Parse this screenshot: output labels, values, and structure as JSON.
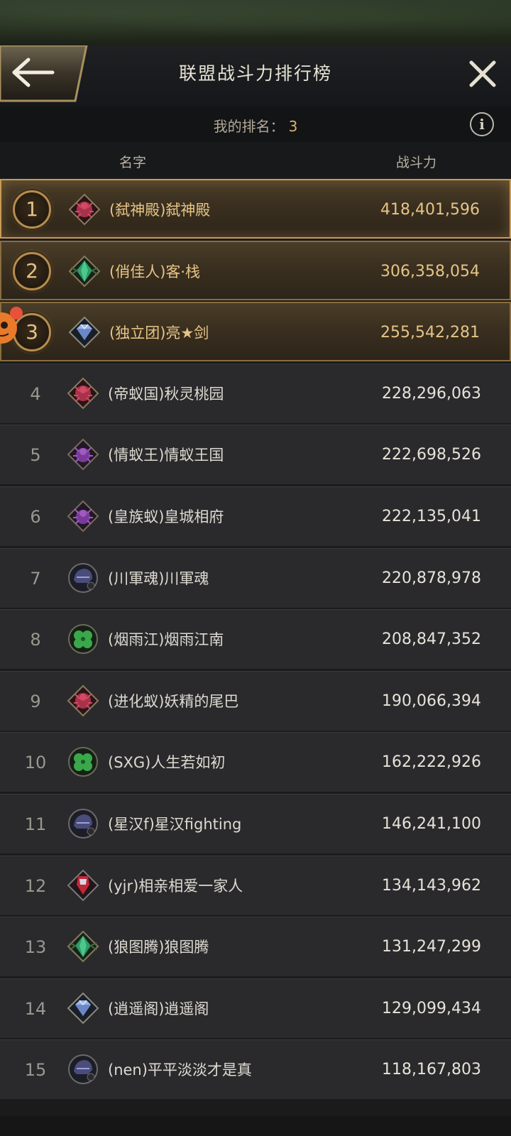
{
  "header": {
    "title": "联盟战斗力排行榜"
  },
  "myrank": {
    "label": "我的排名：",
    "value": "3"
  },
  "columns": {
    "name": "名字",
    "power": "战斗力"
  },
  "colors": {
    "gold": "#e6c486",
    "row": "#2a2a2c",
    "accent_border": "#c89b55"
  },
  "rows": [
    {
      "rank": "1",
      "name": "(弑神殿)弑神殿",
      "power": "418,401,596",
      "emblem": "spider-red-emblem-icon"
    },
    {
      "rank": "2",
      "name": "(俏佳人)客·栈",
      "power": "306,358,054",
      "emblem": "green-crystal-emblem-icon"
    },
    {
      "rank": "3",
      "name": "(独立团)亮★剑",
      "power": "255,542,281",
      "emblem": "diamond-emblem-icon"
    },
    {
      "rank": "4",
      "name": "(帝蚁国)秋灵桃园",
      "power": "228,296,063",
      "emblem": "spider-red-emblem-icon"
    },
    {
      "rank": "5",
      "name": "(情蚁王)情蚁王国",
      "power": "222,698,526",
      "emblem": "spider-purple-emblem-icon"
    },
    {
      "rank": "6",
      "name": "(皇族蚁)皇城相府",
      "power": "222,135,041",
      "emblem": "spider-purple-emblem-icon"
    },
    {
      "rank": "7",
      "name": "(川軍魂)川軍魂",
      "power": "220,878,978",
      "emblem": "helmet-emblem-icon"
    },
    {
      "rank": "8",
      "name": "(烟雨江)烟雨江南",
      "power": "208,847,352",
      "emblem": "clover-emblem-icon"
    },
    {
      "rank": "9",
      "name": "(进化蚁)妖精的尾巴",
      "power": "190,066,394",
      "emblem": "spider-red-emblem-icon"
    },
    {
      "rank": "10",
      "name": "(SXG)人生若如初",
      "power": "162,222,926",
      "emblem": "clover-emblem-icon"
    },
    {
      "rank": "11",
      "name": "(星汉f)星汉fighting",
      "power": "146,241,100",
      "emblem": "helmet-emblem-icon"
    },
    {
      "rank": "12",
      "name": "(yjr)相亲相爱一家人",
      "power": "134,143,962",
      "emblem": "red-knight-emblem-icon"
    },
    {
      "rank": "13",
      "name": "(狼图腾)狼图腾",
      "power": "131,247,299",
      "emblem": "green-crystal-emblem-icon"
    },
    {
      "rank": "14",
      "name": "(逍遥阁)逍遥阁",
      "power": "129,099,434",
      "emblem": "diamond-emblem-icon"
    },
    {
      "rank": "15",
      "name": "(nen)平平淡淡才是真",
      "power": "118,167,803",
      "emblem": "helmet-emblem-icon"
    }
  ]
}
